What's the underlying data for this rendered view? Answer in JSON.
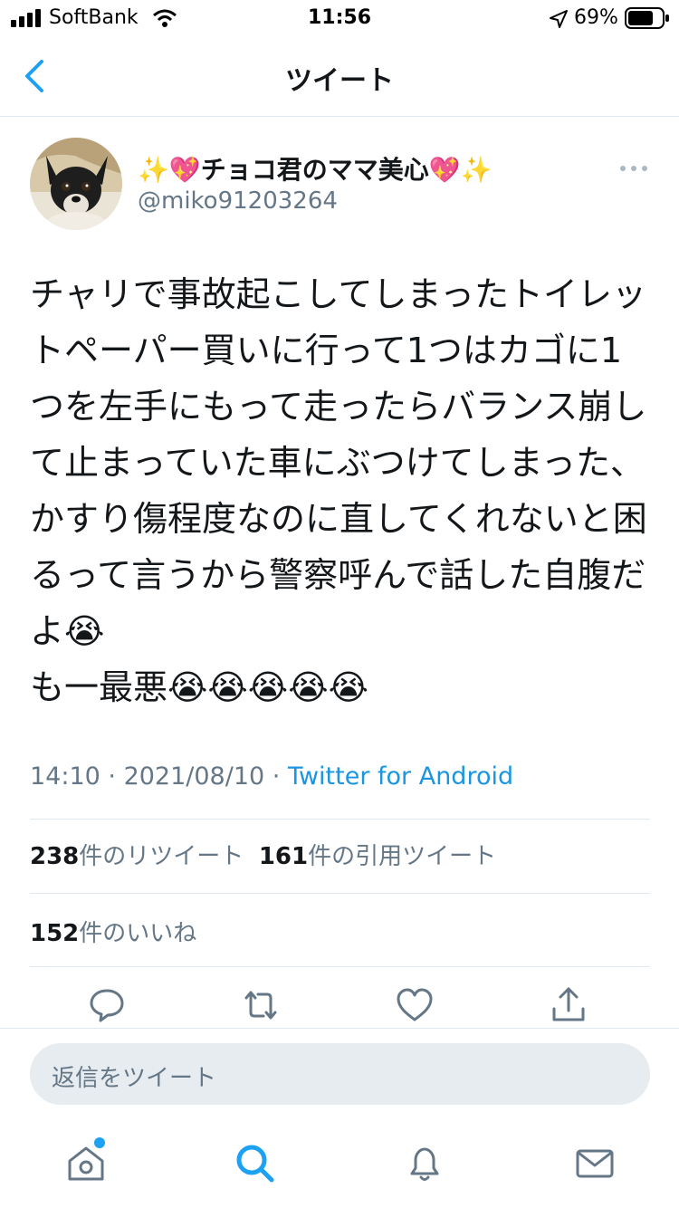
{
  "status_bar": {
    "carrier": "SoftBank",
    "time": "11:56",
    "battery": "69%"
  },
  "nav": {
    "title": "ツイート"
  },
  "tweet": {
    "display_name": "✨💖チョコ君のママ美心💖✨",
    "handle": "@miko91203264",
    "text": "チャリで事故起こしてしまったトイレットペーパー買いに行って1つはカゴに1つを左手にもって走ったらバランス崩して止まっていた車にぶつけてしまった、かすり傷程度なのに直してくれないと困るって言うから警察呼んで話した自腹だよ😭\nも一最悪😭😭😭😭😭",
    "time": "14:10",
    "date": "2021/08/10",
    "source": "Twitter for Android"
  },
  "stats": {
    "retweets_count": "238",
    "retweets_label": "件のリツイート",
    "quotes_count": "161",
    "quotes_label": "件の引用ツイート",
    "likes_count": "152",
    "likes_label": "件のいいね"
  },
  "reply": {
    "placeholder": "返信をツイート"
  },
  "colors": {
    "accent": "#1da1f2",
    "link": "#1b95e0",
    "muted": "#657786",
    "divider": "#e1e8ed"
  },
  "icons": [
    "back-chevron-icon",
    "more-icon",
    "reply-icon",
    "retweet-icon",
    "like-icon",
    "share-icon",
    "home-icon",
    "search-icon",
    "notifications-icon",
    "messages-icon"
  ]
}
